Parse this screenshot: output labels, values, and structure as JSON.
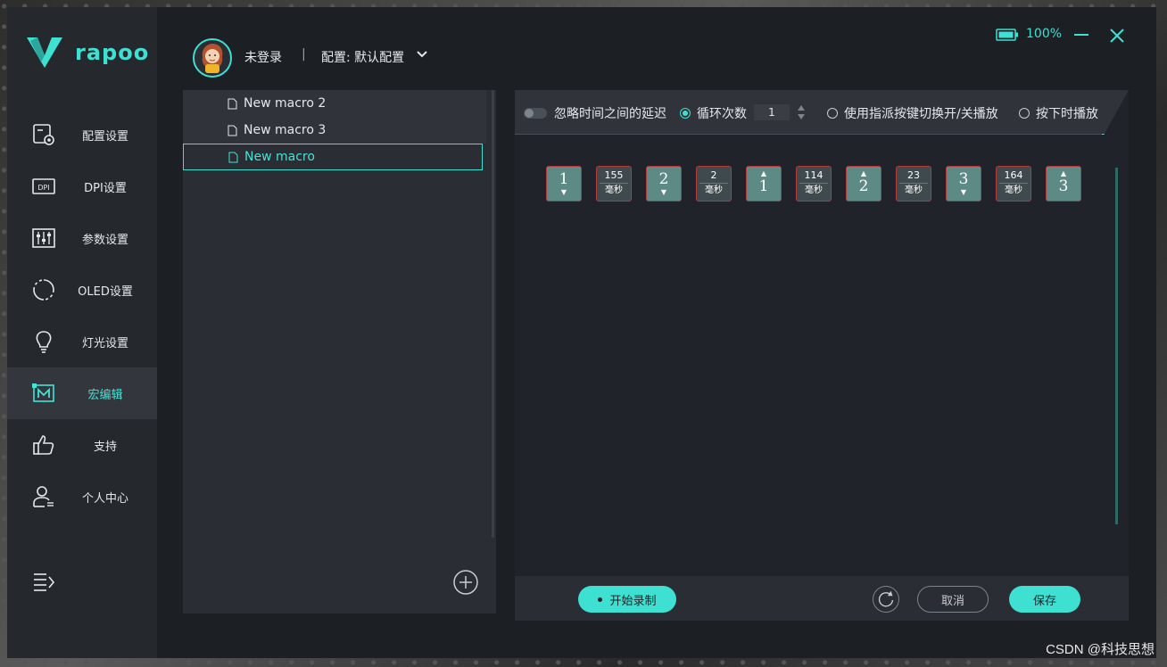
{
  "app": {
    "brand": "rapoo",
    "accent": "#3ee0d2"
  },
  "sidebar": {
    "items": [
      {
        "label": "配置设置",
        "icon": "config-settings-icon"
      },
      {
        "label": "DPI设置",
        "icon": "dpi-icon"
      },
      {
        "label": "参数设置",
        "icon": "sliders-icon"
      },
      {
        "label": "OLED设置",
        "icon": "oled-icon"
      },
      {
        "label": "灯光设置",
        "icon": "lightbulb-icon"
      },
      {
        "label": "宏编辑",
        "icon": "macro-icon",
        "active": true
      },
      {
        "label": "支持",
        "icon": "thumbs-up-icon"
      },
      {
        "label": "个人中心",
        "icon": "user-icon"
      }
    ]
  },
  "header": {
    "user": "未登录",
    "separator": "|",
    "config": "配置: 默认配置",
    "battery": "100%"
  },
  "macros": {
    "items": [
      "New macro 2",
      "New macro 3",
      "New macro"
    ],
    "selected_index": 2
  },
  "options": {
    "ignore_delay": "忽略时间之间的延迟",
    "loop_label": "循环次数",
    "loop_count": "1",
    "toggle_by_key": "使用指派按键切换开/关播放",
    "play_while_pressed": "按下时播放"
  },
  "events": [
    {
      "type": "key",
      "key": "1",
      "dir": "down"
    },
    {
      "type": "delay",
      "value": "155",
      "unit": "毫秒"
    },
    {
      "type": "key",
      "key": "2",
      "dir": "down"
    },
    {
      "type": "delay",
      "value": "2",
      "unit": "毫秒"
    },
    {
      "type": "key",
      "key": "1",
      "dir": "up"
    },
    {
      "type": "delay",
      "value": "114",
      "unit": "毫秒"
    },
    {
      "type": "key",
      "key": "2",
      "dir": "up"
    },
    {
      "type": "delay",
      "value": "23",
      "unit": "毫秒"
    },
    {
      "type": "key",
      "key": "3",
      "dir": "down"
    },
    {
      "type": "delay",
      "value": "164",
      "unit": "毫秒"
    },
    {
      "type": "key",
      "key": "3",
      "dir": "up"
    }
  ],
  "actions": {
    "record": "开始录制",
    "cancel": "取消",
    "save": "保存"
  },
  "watermark": "CSDN @科技思想"
}
